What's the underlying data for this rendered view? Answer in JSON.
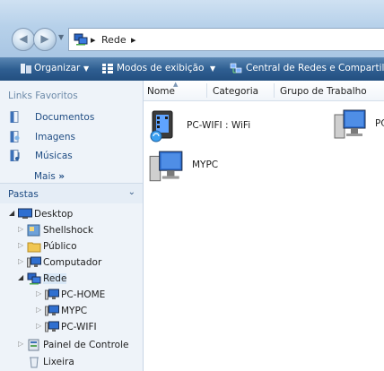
{
  "address": {
    "crumbs": [
      "Rede"
    ],
    "sep": "▸"
  },
  "toolbar": {
    "organize_label": "Organizar",
    "views_label": "Modos de exibição",
    "network_center_label": "Central de Redes e Compartilha"
  },
  "favorites": {
    "title": "Links Favoritos",
    "items": [
      {
        "label": "Documentos",
        "icon": "documents-icon"
      },
      {
        "label": "Imagens",
        "icon": "pictures-icon"
      },
      {
        "label": "Músicas",
        "icon": "music-icon"
      }
    ],
    "more_label": "Mais",
    "more_arrow": "»"
  },
  "folders": {
    "title": "Pastas",
    "chevron": "⌄",
    "tree": [
      {
        "label": "Desktop",
        "icon": "desktop-icon",
        "expander": "◢",
        "level": 0
      },
      {
        "label": "Shellshock",
        "icon": "folder-icon",
        "expander": "▷",
        "level": 1
      },
      {
        "label": "Público",
        "icon": "folder-icon",
        "expander": "▷",
        "level": 1
      },
      {
        "label": "Computador",
        "icon": "computer-icon",
        "expander": "▷",
        "level": 1
      },
      {
        "label": "Rede",
        "icon": "network-icon",
        "expander": "◢",
        "level": 1,
        "selected": true
      },
      {
        "label": "PC-HOME",
        "icon": "computer-icon",
        "expander": "▷",
        "level": 2
      },
      {
        "label": "MYPC",
        "icon": "computer-icon",
        "expander": "▷",
        "level": 2
      },
      {
        "label": "PC-WIFI",
        "icon": "computer-icon",
        "expander": "▷",
        "level": 2
      },
      {
        "label": "Painel de Controle",
        "icon": "control-panel-icon",
        "expander": "▷",
        "level": 1
      },
      {
        "label": "Lixeira",
        "icon": "recycle-bin-icon",
        "expander": "",
        "level": 1
      }
    ]
  },
  "columns": [
    "Nome",
    "Categoria",
    "Grupo de Trabalho"
  ],
  "items": [
    {
      "label": "PC-WIFI : WiFi",
      "icon": "media-device-icon"
    },
    {
      "label": "PC",
      "icon": "computer-icon"
    },
    {
      "label": "MYPC",
      "icon": "computer-icon"
    }
  ],
  "colors": {
    "toolbar": "#2f5f92",
    "link": "#1f4c83",
    "pane": "#eef3f9"
  }
}
